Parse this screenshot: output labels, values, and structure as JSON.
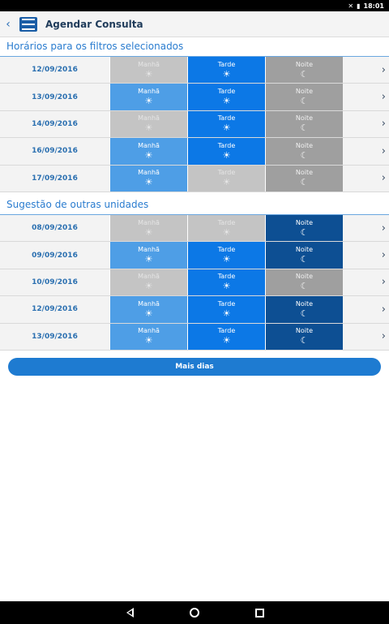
{
  "status": {
    "time": "18:01",
    "signal_icon": "no-signal-icon",
    "battery_icon": "battery-icon"
  },
  "appbar": {
    "title": "Agendar Consulta",
    "back_icon": "chevron-left-icon",
    "menu_icon": "hamburger-menu-icon"
  },
  "labels": {
    "manha": "Manhã",
    "tarde": "Tarde",
    "noite": "Noite"
  },
  "section1": {
    "title": "Horários para os filtros selecionados",
    "rows": [
      {
        "date": "12/09/2016",
        "manha": "disabled",
        "tarde": "tarde",
        "noite": "noite-gray"
      },
      {
        "date": "13/09/2016",
        "manha": "manha",
        "tarde": "tarde",
        "noite": "noite-gray"
      },
      {
        "date": "14/09/2016",
        "manha": "disabled",
        "tarde": "tarde",
        "noite": "noite-gray"
      },
      {
        "date": "16/09/2016",
        "manha": "manha",
        "tarde": "tarde",
        "noite": "noite-gray"
      },
      {
        "date": "17/09/2016",
        "manha": "manha",
        "tarde": "disabled",
        "noite": "noite-gray"
      }
    ]
  },
  "section2": {
    "title": "Sugestão de outras unidades",
    "rows": [
      {
        "date": "08/09/2016",
        "manha": "disabled",
        "tarde": "disabled",
        "noite": "noite-blue"
      },
      {
        "date": "09/09/2016",
        "manha": "manha",
        "tarde": "tarde",
        "noite": "noite-blue"
      },
      {
        "date": "10/09/2016",
        "manha": "disabled",
        "tarde": "tarde",
        "noite": "noite-gray"
      },
      {
        "date": "12/09/2016",
        "manha": "manha",
        "tarde": "tarde",
        "noite": "noite-blue"
      },
      {
        "date": "13/09/2016",
        "manha": "manha",
        "tarde": "tarde",
        "noite": "noite-blue"
      }
    ]
  },
  "more_button": {
    "label": "Mais dias"
  },
  "colors": {
    "accent": "#1e7bd1",
    "manha": "#4e9ee6",
    "tarde": "#0c78e6",
    "noite_blue": "#0d4f93",
    "noite_gray": "#9f9f9f",
    "disabled": "#c4c4c4"
  }
}
